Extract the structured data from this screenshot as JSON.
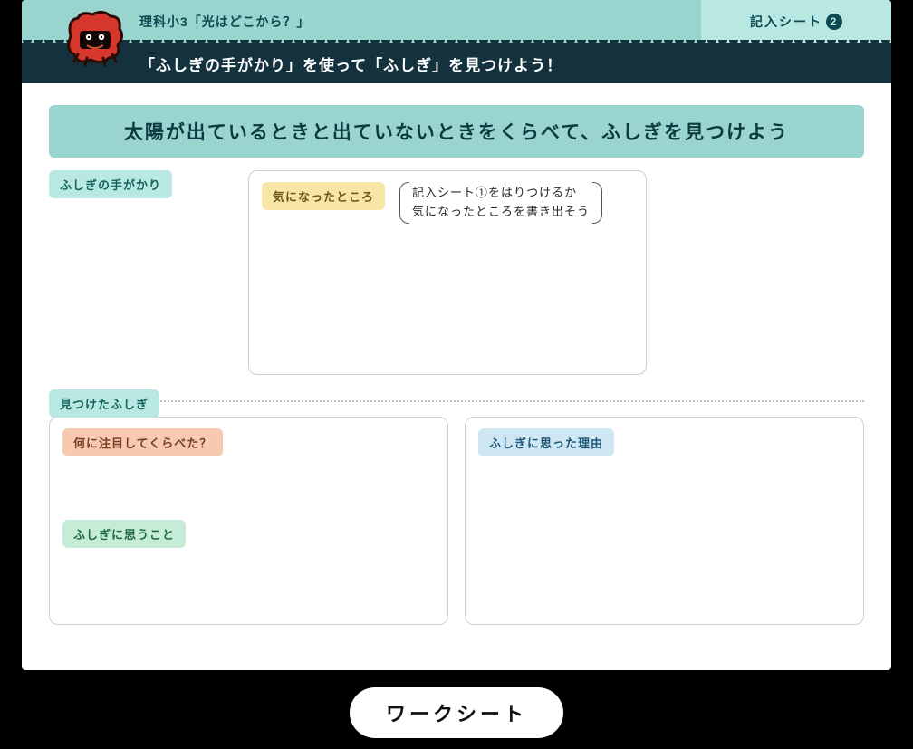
{
  "header": {
    "course_title": "理科小3「光はどこから？」",
    "sheet_label": "記入シート",
    "sheet_number": "2"
  },
  "subbanner": "「ふしぎの手がかり」を使って「ふしぎ」を見つけよう！",
  "main_prompt": "太陽が出ているときと出ていないときをくらべて、ふしぎを見つけよう",
  "clue_label": "ふしぎの手がかり",
  "noticed": {
    "label": "気になったところ",
    "hint_line1": "記入シート①をはりつけるか",
    "hint_line2": "気になったところを書き出そう"
  },
  "found_label": "見つけたふしぎ",
  "left_box": {
    "q1": "何に注目してくらべた？",
    "q2": "ふしぎに思うこと"
  },
  "right_box": {
    "q1": "ふしぎに思った理由"
  },
  "footer_button": "ワークシート"
}
